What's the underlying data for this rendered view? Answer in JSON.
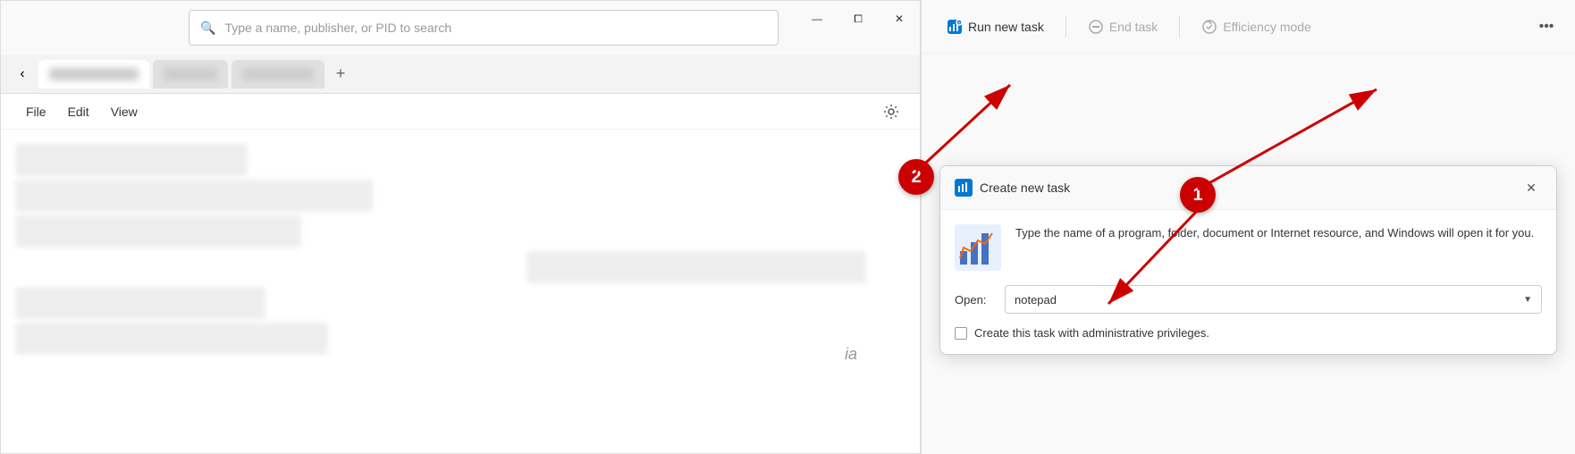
{
  "search": {
    "placeholder": "Type a name, publisher, or PID to search"
  },
  "window_controls": {
    "minimize": "—",
    "maximize": "⧠",
    "close": "✕"
  },
  "menu": {
    "file": "File",
    "edit": "Edit",
    "view": "View"
  },
  "toolbar": {
    "run_new_task_label": "Run new task",
    "end_task_label": "End task",
    "efficiency_mode_label": "Efficiency mode",
    "more_label": "•••"
  },
  "dialog": {
    "title": "Create new task",
    "description": "Type the name of a program, folder, document or Internet resource, and Windows will open it for you.",
    "open_label": "Open:",
    "open_value": "notepad",
    "checkbox_label": "Create this task with administrative privileges.",
    "close": "✕"
  },
  "annotation": {
    "circle1_label": "1",
    "circle2_label": "2"
  },
  "blurred_text": {
    "ia": "ia"
  }
}
